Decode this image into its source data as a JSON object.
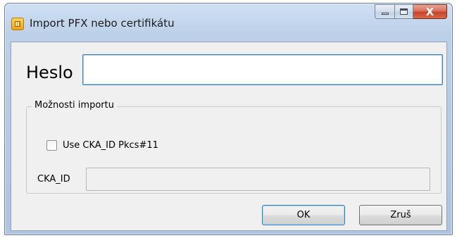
{
  "window": {
    "title": "Import PFX nebo certifikátu",
    "icon": "smartcard-icon",
    "close_glyph": "X"
  },
  "form": {
    "password_label": "Heslo",
    "password_value": "",
    "options_group_title": "Možnosti importu",
    "use_cka_id_label": "Use CKA_ID Pkcs#11",
    "use_cka_id_checked": false,
    "cka_id_label": "CKA_ID",
    "cka_id_value": "",
    "cka_id_enabled": false
  },
  "buttons": {
    "ok_label": "OK",
    "cancel_label": "Zruš"
  },
  "colors": {
    "focus_border": "#3c7fb1",
    "close_button": "#c6432a"
  }
}
